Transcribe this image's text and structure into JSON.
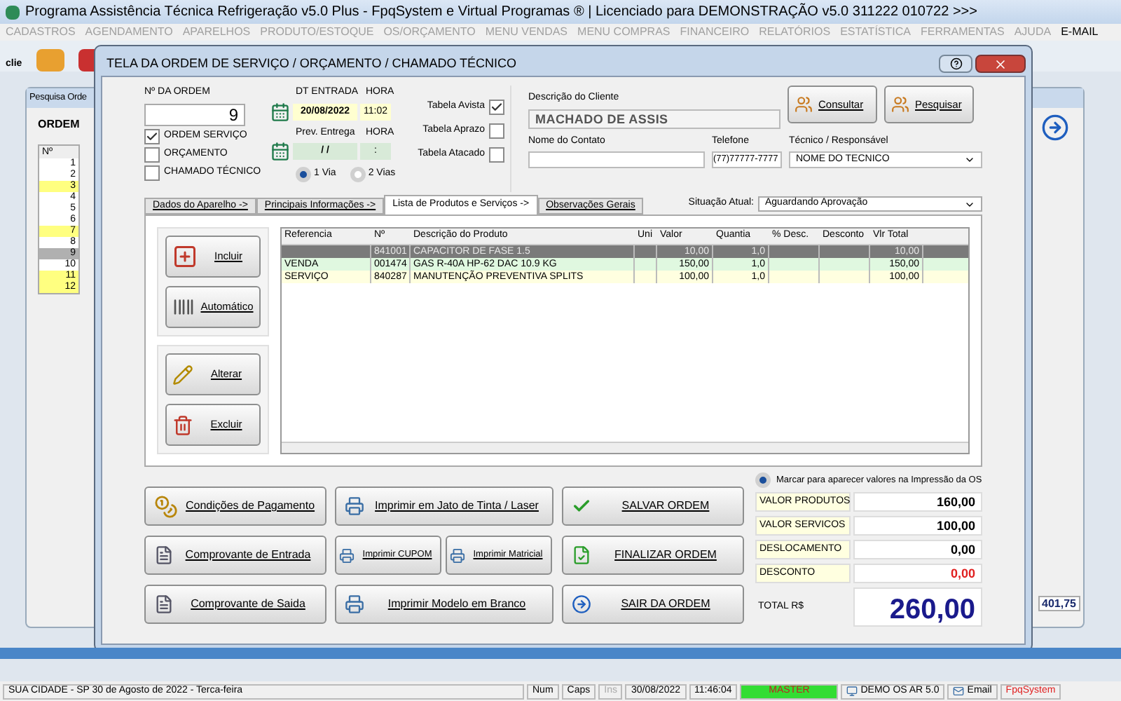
{
  "window": {
    "title": "Programa Assistência Técnica Refrigeração v5.0 Plus - FpqSystem e Virtual Programas ® | Licenciado para  DEMONSTRAÇÃO v5.0 311222 010722 >>>"
  },
  "menu": [
    {
      "label": "CADASTROS",
      "disabled": true
    },
    {
      "label": "AGENDAMENTO",
      "disabled": true
    },
    {
      "label": "APARELHOS",
      "disabled": true
    },
    {
      "label": "PRODUTO/ESTOQUE",
      "disabled": true
    },
    {
      "label": "OS/ORÇAMENTO",
      "disabled": true
    },
    {
      "label": "MENU VENDAS",
      "disabled": true
    },
    {
      "label": "MENU COMPRAS",
      "disabled": true
    },
    {
      "label": "FINANCEIRO",
      "disabled": true
    },
    {
      "label": "RELATÓRIOS",
      "disabled": true
    },
    {
      "label": "ESTATÍSTICA",
      "disabled": true
    },
    {
      "label": "FERRAMENTAS",
      "disabled": true
    },
    {
      "label": "AJUDA",
      "disabled": true
    },
    {
      "label": "E-MAIL",
      "disabled": false
    }
  ],
  "toolbar": {
    "first_label": "clie"
  },
  "background_window": {
    "title": "Pesquisa Orde",
    "heading": "ORDEM",
    "column_1": "Nº",
    "total": "401,75",
    "rows": [
      {
        "number": "1",
        "color": "#ffffff"
      },
      {
        "number": "2",
        "color": "#ffffff"
      },
      {
        "number": "3",
        "color": "#ffff80"
      },
      {
        "number": "4",
        "color": "#ffffff"
      },
      {
        "number": "5",
        "color": "#ffffff"
      },
      {
        "number": "6",
        "color": "#ffffff"
      },
      {
        "number": "7",
        "color": "#ffff80"
      },
      {
        "number": "8",
        "color": "#ffffff"
      },
      {
        "number": "9",
        "color": "#b0b0b0"
      },
      {
        "number": "10",
        "color": "#ffffff"
      },
      {
        "number": "11",
        "color": "#ffff80"
      },
      {
        "number": "12",
        "color": "#ffff80"
      }
    ]
  },
  "dialog": {
    "title": "TELA DA ORDEM DE SERVIÇO / ORÇAMENTO / CHAMADO TÉCNICO",
    "order_number": {
      "label": "Nº DA ORDEM",
      "value": "9"
    },
    "order_types": [
      {
        "label": "ORDEM SERVIÇO",
        "checked": true
      },
      {
        "label": "ORÇAMENTO",
        "checked": false
      },
      {
        "label": "CHAMADO TÉCNICO",
        "checked": false
      }
    ],
    "entry": {
      "date_label": "DT ENTRADA",
      "time_label": "HORA",
      "date": "20/08/2022",
      "time": "11:02"
    },
    "delivery": {
      "date_label": "Prev. Entrega",
      "time_label": "HORA",
      "date": "/ /",
      "time": ":"
    },
    "copies": [
      {
        "label": "1 Via",
        "selected": true
      },
      {
        "label": "2 Vias",
        "selected": false
      }
    ],
    "price_tables": [
      {
        "label": "Tabela Avista",
        "checked": true
      },
      {
        "label": "Tabela Aprazo",
        "checked": false
      },
      {
        "label": "Tabela Atacado",
        "checked": false
      }
    ],
    "client": {
      "label": "Descrição do Cliente",
      "value": "MACHADO DE ASSIS"
    },
    "client_buttons": [
      "Consultar",
      "Pesquisar"
    ],
    "contact": {
      "label": "Nome do Contato"
    },
    "phone": {
      "label": "Telefone",
      "value": "(77)77777-7777"
    },
    "technician": {
      "label": "Técnico / Responsável",
      "value": "NOME DO TECNICO"
    },
    "tabs": [
      {
        "label": "Dados do Aparelho ->",
        "selected": false
      },
      {
        "label": "Principais Informações ->",
        "selected": false
      },
      {
        "label": "Lista de Produtos e Serviços ->",
        "selected": true
      },
      {
        "label": "Observações Gerais",
        "selected": false
      }
    ],
    "status": {
      "label": "Situação Atual:",
      "value": "Aguardando Aprovação"
    },
    "list_buttons": [
      {
        "label": "Incluir",
        "kind": "add"
      },
      {
        "label": "Automático",
        "kind": "auto"
      },
      {
        "label": "Alterar",
        "kind": "edit"
      },
      {
        "label": "Excluir",
        "kind": "delete"
      }
    ],
    "table": {
      "columns": [
        "Referencia",
        "Nº",
        "Descrição do Produto",
        "Uni",
        "Valor",
        "Quantia",
        "% Desc.",
        "Desconto",
        "Vlr Total"
      ],
      "rows": [
        {
          "selected": true,
          "cells": [
            "",
            "841001",
            "CAPACITOR DE FASE 1.5",
            "",
            "10,00",
            "1,0",
            "",
            "",
            "10,00"
          ]
        },
        {
          "selected": false,
          "color": "#e0f8e0",
          "cells": [
            "VENDA",
            "001474",
            "GAS R-40A HP-62 DAC 10.9 KG",
            "",
            "150,00",
            "1,0",
            "",
            "",
            "150,00"
          ]
        },
        {
          "selected": false,
          "color": "#ffffe0",
          "cells": [
            "SERVIÇO",
            "840287",
            "MANUTENÇÃO PREVENTIVA SPLITS",
            "",
            "100,00",
            "1,0",
            "",
            "",
            "100,00"
          ]
        }
      ]
    },
    "action_buttons": [
      {
        "label": "Condições de Pagamento",
        "kind": "coins"
      },
      {
        "label": "Imprimir em Jato de Tinta / Laser",
        "kind": "printer"
      },
      {
        "label": "SALVAR ORDEM",
        "kind": "check"
      },
      {
        "label": "Comprovante de Entrada",
        "kind": "doc"
      },
      {
        "label": "Imprimir CUPOM",
        "kind": "printer"
      },
      {
        "label": "Imprimir Matricial",
        "kind": "printer"
      },
      {
        "label": "FINALIZAR ORDEM",
        "kind": "finish"
      },
      {
        "label": "Comprovante de Saida",
        "kind": "doc"
      },
      {
        "label": "Imprimir Modelo em Branco",
        "kind": "printer"
      },
      {
        "label": "SAIR DA ORDEM",
        "kind": "exit"
      }
    ],
    "print_values": {
      "label": "Marcar para aparecer valores na Impressão da OS",
      "selected": true
    },
    "totals": [
      {
        "label": "VALOR PRODUTOS",
        "value": "160,00",
        "kind": "normal"
      },
      {
        "label": "VALOR SERVICOS",
        "value": "100,00",
        "kind": "normal"
      },
      {
        "label": "DESLOCAMENTO",
        "value": "0,00",
        "kind": "normal"
      },
      {
        "label": "DESCONTO",
        "value": "0,00",
        "kind": "negative"
      }
    ],
    "grand_total": {
      "label": "TOTAL R$",
      "value": "260,00"
    }
  },
  "status_bar": [
    {
      "text": "SUA CIDADE - SP 30 de Agosto de 2022 - Terca-feira",
      "kind": "wide"
    },
    {
      "text": "Num",
      "kind": "plain"
    },
    {
      "text": "Caps",
      "kind": "plain"
    },
    {
      "text": "Ins",
      "kind": "disabled"
    },
    {
      "text": "30/08/2022",
      "kind": "plain"
    },
    {
      "text": "11:46:04",
      "kind": "plain"
    },
    {
      "text": "MASTER",
      "kind": "user"
    },
    {
      "text": "DEMO OS AR 5.0",
      "kind": "icon"
    },
    {
      "text": "Email",
      "kind": "icon"
    },
    {
      "text": "FpqSystem",
      "kind": "brand"
    }
  ]
}
